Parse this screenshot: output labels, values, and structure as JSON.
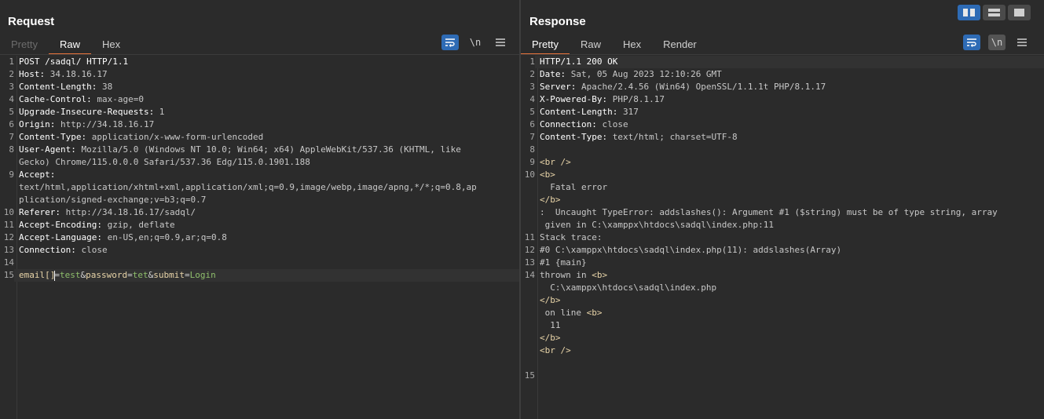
{
  "layout_switch": {
    "active": "side-by-side",
    "accent": "#2e6bb5"
  },
  "request": {
    "title": "Request",
    "tabs": [
      {
        "label": "Pretty",
        "state": "disabled"
      },
      {
        "label": "Raw",
        "state": "active"
      },
      {
        "label": "Hex",
        "state": "normal"
      }
    ],
    "toolbar": {
      "newline_label": "\\n",
      "icons": [
        "wrap-lines-icon",
        "newline-icon",
        "menu-icon"
      ]
    },
    "lines": [
      {
        "n": "1",
        "parts": [
          {
            "t": "POST /sadql/ HTTP/1.1",
            "c": "k"
          }
        ]
      },
      {
        "n": "2",
        "parts": [
          {
            "t": "Host:",
            "c": "k"
          },
          {
            "t": " 34.18.16.17",
            "c": "hv"
          }
        ]
      },
      {
        "n": "3",
        "parts": [
          {
            "t": "Content-Length:",
            "c": "k"
          },
          {
            "t": " 38",
            "c": "hv"
          }
        ]
      },
      {
        "n": "4",
        "parts": [
          {
            "t": "Cache-Control:",
            "c": "k"
          },
          {
            "t": " max-age=0",
            "c": "hv"
          }
        ]
      },
      {
        "n": "5",
        "parts": [
          {
            "t": "Upgrade-Insecure-Requests:",
            "c": "k"
          },
          {
            "t": " 1",
            "c": "hv"
          }
        ]
      },
      {
        "n": "6",
        "parts": [
          {
            "t": "Origin:",
            "c": "k"
          },
          {
            "t": " http://34.18.16.17",
            "c": "hv"
          }
        ]
      },
      {
        "n": "7",
        "parts": [
          {
            "t": "Content-Type:",
            "c": "k"
          },
          {
            "t": " application/x-www-form-urlencoded",
            "c": "hv"
          }
        ]
      },
      {
        "n": "8",
        "parts": [
          {
            "t": "User-Agent:",
            "c": "k"
          },
          {
            "t": " Mozilla/5.0 (Windows NT 10.0; Win64; x64) AppleWebKit/537.36 (KHTML, like",
            "c": "hv"
          }
        ]
      },
      {
        "n": "",
        "parts": [
          {
            "t": "Gecko) Chrome/115.0.0.0 Safari/537.36 Edg/115.0.1901.188",
            "c": "hv"
          }
        ]
      },
      {
        "n": "9",
        "parts": [
          {
            "t": "Accept:",
            "c": "k"
          }
        ]
      },
      {
        "n": "",
        "parts": [
          {
            "t": "text/html,application/xhtml+xml,application/xml;q=0.9,image/webp,image/apng,*/*;q=0.8,ap",
            "c": "hv"
          }
        ]
      },
      {
        "n": "",
        "parts": [
          {
            "t": "plication/signed-exchange;v=b3;q=0.7",
            "c": "hv"
          }
        ]
      },
      {
        "n": "10",
        "parts": [
          {
            "t": "Referer:",
            "c": "k"
          },
          {
            "t": " http://34.18.16.17/sadql/",
            "c": "hv"
          }
        ]
      },
      {
        "n": "11",
        "parts": [
          {
            "t": "Accept-Encoding:",
            "c": "k"
          },
          {
            "t": " gzip, deflate",
            "c": "hv"
          }
        ]
      },
      {
        "n": "12",
        "parts": [
          {
            "t": "Accept-Language:",
            "c": "k"
          },
          {
            "t": " en-US,en;q=0.9,ar;q=0.8",
            "c": "hv"
          }
        ]
      },
      {
        "n": "13",
        "parts": [
          {
            "t": "Connection:",
            "c": "k"
          },
          {
            "t": " close",
            "c": "hv"
          }
        ]
      },
      {
        "n": "14",
        "parts": []
      },
      {
        "n": "15",
        "current": true,
        "parts": [
          {
            "t": "email[]",
            "c": "pn"
          },
          {
            "caret": true
          },
          {
            "t": "=",
            "c": "amp"
          },
          {
            "t": "test",
            "c": "pv"
          },
          {
            "t": "&",
            "c": "amp"
          },
          {
            "t": "password",
            "c": "pn"
          },
          {
            "t": "=",
            "c": "amp"
          },
          {
            "t": "tet",
            "c": "pv"
          },
          {
            "t": "&",
            "c": "amp"
          },
          {
            "t": "submit",
            "c": "pn"
          },
          {
            "t": "=",
            "c": "amp"
          },
          {
            "t": "Login",
            "c": "pv"
          }
        ]
      }
    ]
  },
  "response": {
    "title": "Response",
    "tabs": [
      {
        "label": "Pretty",
        "state": "active"
      },
      {
        "label": "Raw",
        "state": "normal"
      },
      {
        "label": "Hex",
        "state": "normal"
      },
      {
        "label": "Render",
        "state": "normal"
      }
    ],
    "toolbar": {
      "newline_label": "\\n",
      "icons": [
        "wrap-lines-icon",
        "newline-icon",
        "menu-icon"
      ]
    },
    "lines": [
      {
        "n": "1",
        "current": true,
        "parts": [
          {
            "t": "HTTP/1.1 200 OK",
            "c": "k"
          }
        ]
      },
      {
        "n": "2",
        "parts": [
          {
            "t": "Date:",
            "c": "k"
          },
          {
            "t": " Sat, 05 Aug 2023 12:10:26 GMT",
            "c": "hv"
          }
        ]
      },
      {
        "n": "3",
        "parts": [
          {
            "t": "Server:",
            "c": "k"
          },
          {
            "t": " Apache/2.4.56 (Win64) OpenSSL/1.1.1t PHP/8.1.17",
            "c": "hv"
          }
        ]
      },
      {
        "n": "4",
        "parts": [
          {
            "t": "X-Powered-By:",
            "c": "k"
          },
          {
            "t": " PHP/8.1.17",
            "c": "hv"
          }
        ]
      },
      {
        "n": "5",
        "parts": [
          {
            "t": "Content-Length:",
            "c": "k"
          },
          {
            "t": " 317",
            "c": "hv"
          }
        ]
      },
      {
        "n": "6",
        "parts": [
          {
            "t": "Connection:",
            "c": "k"
          },
          {
            "t": " close",
            "c": "hv"
          }
        ]
      },
      {
        "n": "7",
        "parts": [
          {
            "t": "Content-Type:",
            "c": "k"
          },
          {
            "t": " text/html; charset=UTF-8",
            "c": "hv"
          }
        ]
      },
      {
        "n": "8",
        "parts": []
      },
      {
        "n": "9",
        "parts": [
          {
            "t": "<br />",
            "c": "pn"
          }
        ]
      },
      {
        "n": "10",
        "parts": [
          {
            "t": "<b>",
            "c": "pn"
          }
        ]
      },
      {
        "n": "",
        "parts": [
          {
            "t": "  Fatal error",
            "c": "hv"
          }
        ]
      },
      {
        "n": "",
        "parts": [
          {
            "t": "</b>",
            "c": "pn"
          }
        ]
      },
      {
        "n": "",
        "parts": [
          {
            "t": ":  Uncaught TypeError: addslashes(): Argument #1 ($string) must be of type string, array",
            "c": "hv"
          }
        ]
      },
      {
        "n": "",
        "parts": [
          {
            "t": " given in C:\\xamppx\\htdocs\\sadql\\index.php:11",
            "c": "hv"
          }
        ]
      },
      {
        "n": "11",
        "parts": [
          {
            "t": "Stack trace:",
            "c": "hv"
          }
        ]
      },
      {
        "n": "12",
        "parts": [
          {
            "t": "#0 C:\\xamppx\\htdocs\\sadql\\index.php(11): addslashes(Array)",
            "c": "hv"
          }
        ]
      },
      {
        "n": "13",
        "parts": [
          {
            "t": "#1 {main}",
            "c": "hv"
          }
        ]
      },
      {
        "n": "14",
        "parts": [
          {
            "t": "thrown in ",
            "c": "hv"
          },
          {
            "t": "<b>",
            "c": "pn"
          }
        ]
      },
      {
        "n": "",
        "parts": [
          {
            "t": "  C:\\xamppx\\htdocs\\sadql\\index.php",
            "c": "hv"
          }
        ]
      },
      {
        "n": "",
        "parts": [
          {
            "t": "</b>",
            "c": "pn"
          }
        ]
      },
      {
        "n": "",
        "parts": [
          {
            "t": " on line ",
            "c": "hv"
          },
          {
            "t": "<b>",
            "c": "pn"
          }
        ]
      },
      {
        "n": "",
        "parts": [
          {
            "t": "  11",
            "c": "hv"
          }
        ]
      },
      {
        "n": "",
        "parts": [
          {
            "t": "</b>",
            "c": "pn"
          }
        ]
      },
      {
        "n": "",
        "parts": [
          {
            "t": "<br />",
            "c": "pn"
          }
        ]
      },
      {
        "n": "",
        "parts": []
      },
      {
        "n": "15",
        "parts": []
      }
    ]
  }
}
